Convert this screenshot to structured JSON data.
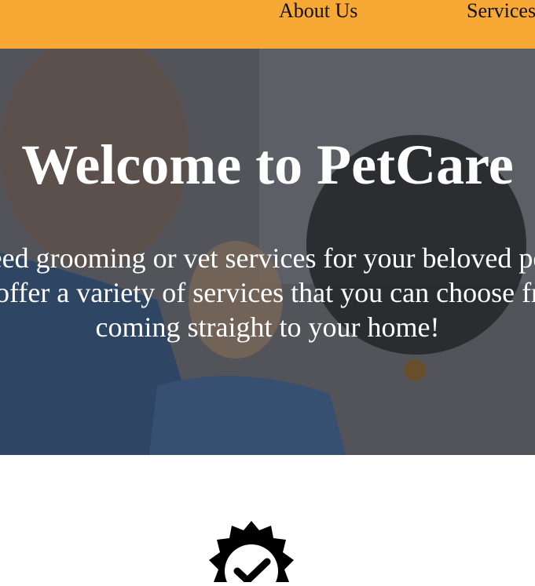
{
  "nav": {
    "links": [
      "About Us",
      "Services"
    ]
  },
  "hero": {
    "title": "Welcome to PetCare",
    "lines": [
      "Need grooming or vet services for your beloved pet?",
      "We offer a variety of services that you can choose from,",
      "coming straight to your home!"
    ]
  },
  "icons": {
    "badge": "verified-badge-icon"
  },
  "colors": {
    "navbar": "#f8a834",
    "hero_text": "#ffffff",
    "icon": "#000000"
  }
}
